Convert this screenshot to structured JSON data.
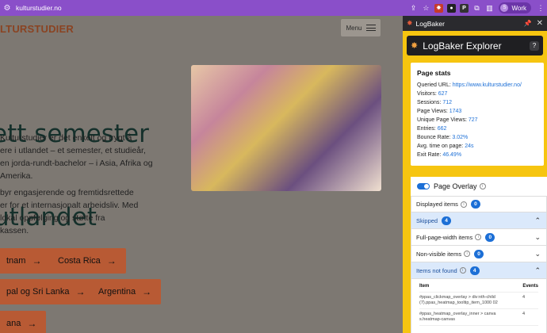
{
  "browser": {
    "url": "kulturstudier.no",
    "profile_initial": "S",
    "profile_label": "Work",
    "extensions": [
      {
        "name": "extension-red",
        "glyph": "✸",
        "color": "#c73a2a"
      },
      {
        "name": "extension-dark",
        "glyph": "●",
        "color": "#222"
      },
      {
        "name": "extension-p",
        "glyph": "P",
        "color": "#333"
      }
    ]
  },
  "page": {
    "logo": "LTURSTUDIER",
    "menu_label": "Menu",
    "hero_lines": [
      "ett semester",
      "utlandet"
    ],
    "para1": [
      "Kulturstudier er det enkelt og trygt å",
      "ere i utlandet – et semester, et studieår,",
      "en jorda-rundt-bachelor – i Asia, Afrika og",
      "Amerika."
    ],
    "para2": [
      "byr engasjerende og fremtidsrettede",
      "er for et internasjonalt arbeidsliv. Med",
      "lokal oppfølging og støtte fra",
      "kassen."
    ],
    "buttons": [
      "tnam",
      "Costa Rica",
      "pal og Sri Lanka",
      "Argentina",
      "ana"
    ]
  },
  "panel": {
    "window_title": "LogBaker",
    "header_title": "LogBaker Explorer",
    "help_label": "?",
    "stats": {
      "heading": "Page stats",
      "rows": [
        {
          "label": "Queried URL:",
          "value": "https://www.kulturstudier.no/"
        },
        {
          "label": "Visitors:",
          "value": "627"
        },
        {
          "label": "Sessions:",
          "value": "712"
        },
        {
          "label": "Page Views:",
          "value": "1743"
        },
        {
          "label": "Unique Page Views:",
          "value": "727"
        },
        {
          "label": "Entries:",
          "value": "662"
        },
        {
          "label": "Bounce Rate:",
          "value": "3.02%"
        },
        {
          "label": "Avg. time on page:",
          "value": "24s"
        },
        {
          "label": "Exit Rate:",
          "value": "46.49%"
        }
      ]
    },
    "overlay": {
      "label": "Page Overlay",
      "enabled": true,
      "sections": [
        {
          "label": "Displayed items",
          "count": "0",
          "open": false,
          "chevron": ""
        },
        {
          "label": "Skipped",
          "count": "4",
          "open": true,
          "chevron": "⌃"
        },
        {
          "label": "Full-page-width items",
          "count": "0",
          "open": false,
          "chevron": "⌄"
        },
        {
          "label": "Non-visible items",
          "count": "0",
          "open": false,
          "chevron": "⌄"
        },
        {
          "label": "Items not found",
          "count": "4",
          "open": true,
          "chevron": "⌃"
        }
      ],
      "table": {
        "col_item": "Item",
        "col_events": "Events",
        "rows": [
          {
            "selector": "#ppas_clickmap_overlay > div:nth-child(7).ppas_heatmap_tooltip_item_1000 02",
            "events": "4"
          },
          {
            "selector": "#ppas_heatmap_overlay_inner > canvas.heatmap-canvas",
            "events": "4"
          }
        ]
      }
    }
  }
}
